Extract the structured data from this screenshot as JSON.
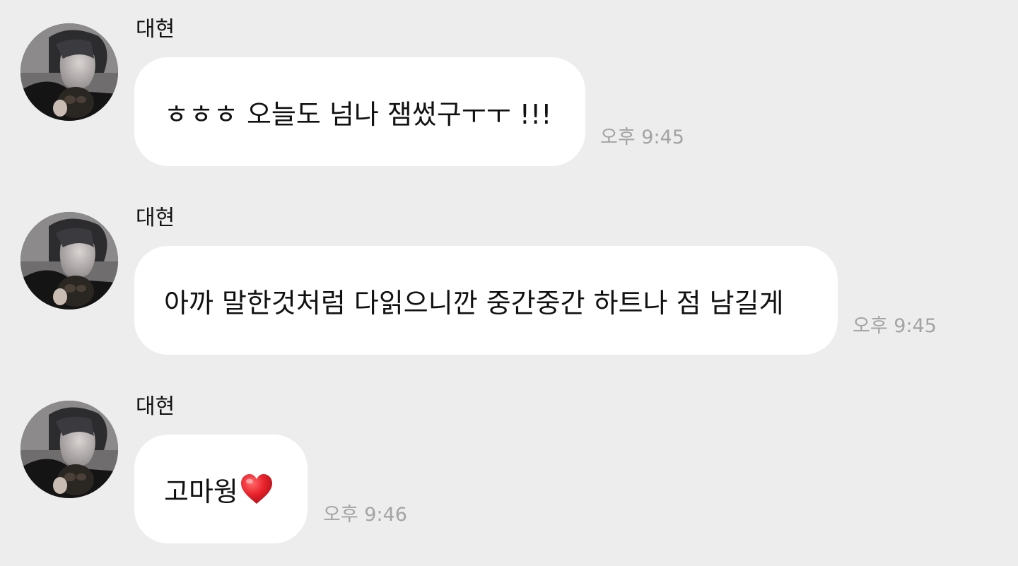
{
  "messages": [
    {
      "sender": "대현",
      "text": "ㅎㅎㅎ 오늘도 넘나 잼썼구ㅜㅜ !!!",
      "time": "오후 9:45",
      "avatar": "profile-photo-icon"
    },
    {
      "sender": "대현",
      "text": "아까 말한것처럼 다읽으니깐 중간중간 하트나 점 남길게",
      "time": "오후 9:45",
      "avatar": "profile-photo-icon"
    },
    {
      "sender": "대현",
      "text": "고마웡",
      "emoji": "heart-icon",
      "time": "오후 9:46",
      "avatar": "profile-photo-icon"
    }
  ],
  "colors": {
    "background": "#ededed",
    "bubble": "#ffffff",
    "text": "#111111",
    "timestamp": "#a3a3a3",
    "heart": "#e8222b"
  }
}
